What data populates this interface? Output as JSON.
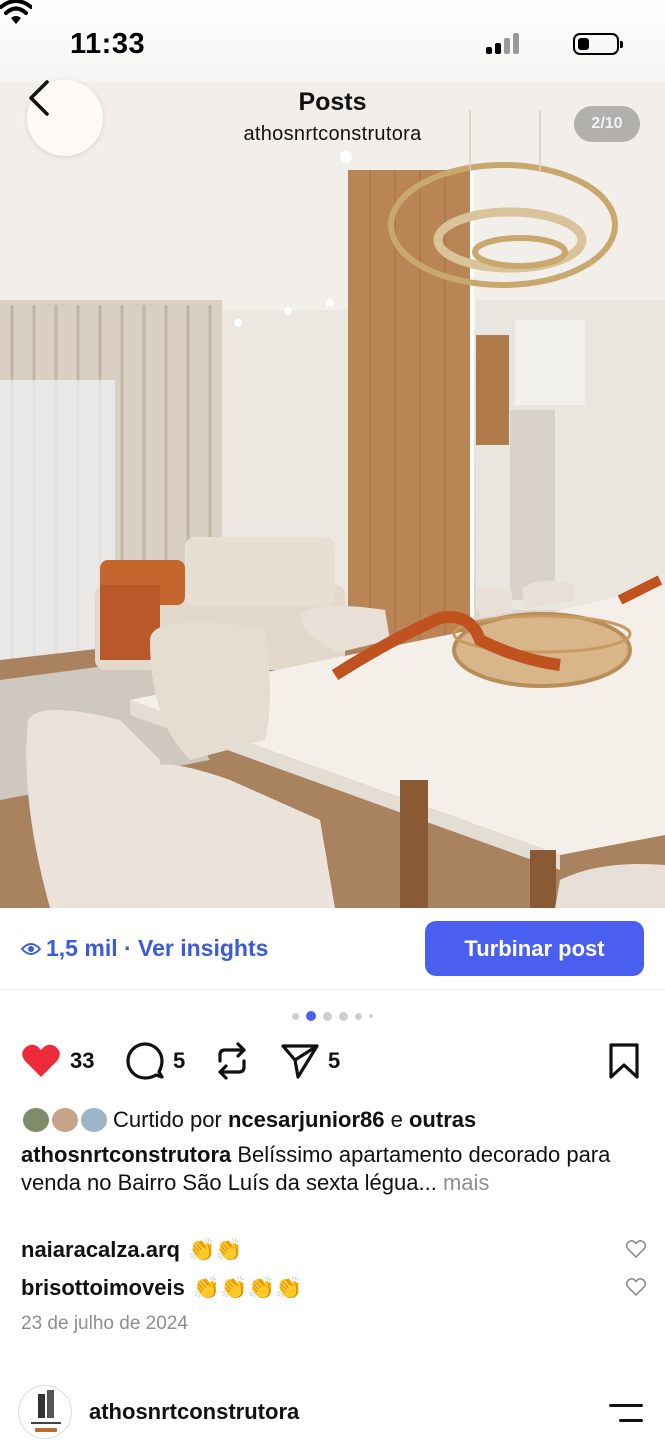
{
  "status_bar": {
    "time": "11:33"
  },
  "header": {
    "title": "Posts",
    "account": "athosnrtconstrutora",
    "counter": "2/10"
  },
  "insights": {
    "views_label": "1,5 mil · Ver insights",
    "boost_label": "Turbinar post"
  },
  "carousel": {
    "total_dots": 6,
    "active_index": 1
  },
  "actions": {
    "likes": "33",
    "comments": "5",
    "shares": "5"
  },
  "liked_by": {
    "prefix": "Curtido por",
    "user": "ncesarjunior86",
    "joiner": "e",
    "others": "outras"
  },
  "caption": {
    "user": "athosnrtconstrutora",
    "text": "Belíssimo apartamento decorado para venda no Bairro São Luís da sexta légua...",
    "more": "mais"
  },
  "comments": [
    {
      "user": "naiaracalza.arq",
      "text": "👏👏"
    },
    {
      "user": "brisottoimoveis",
      "text": "👏👏👏👏"
    }
  ],
  "date": "23 de julho de 2024",
  "next_post": {
    "account": "athosnrtconstrutora"
  },
  "colors": {
    "accent": "#4a5ef0",
    "link": "#3b5bdb",
    "like": "#ed2a3a"
  }
}
